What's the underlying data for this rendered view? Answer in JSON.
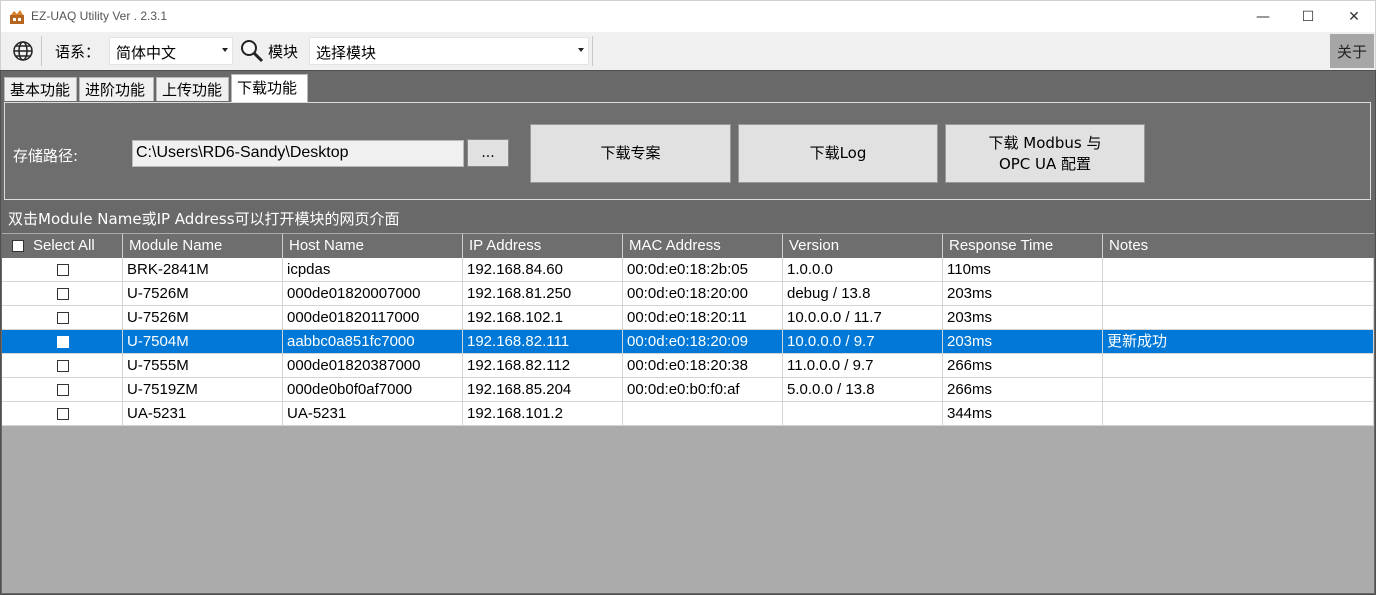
{
  "window": {
    "title": "EZ-UAQ Utility Ver . 2.3.1",
    "minimize_glyph": "—",
    "maximize_glyph": "☐",
    "close_glyph": "✕"
  },
  "toolbar": {
    "language_label": "语系：",
    "language_value": "简体中文",
    "module_label": "模块",
    "module_value": "选择模块",
    "about_label": "关于",
    "globe_icon": "globe-icon",
    "search_icon": "magnifier-icon"
  },
  "tabs": [
    {
      "label": "基本功能",
      "active": false
    },
    {
      "label": "进阶功能",
      "active": false
    },
    {
      "label": "上传功能",
      "active": false
    },
    {
      "label": "下载功能",
      "active": true
    }
  ],
  "download_panel": {
    "path_label": "存储路径:",
    "path_value": "C:\\Users\\RD6-Sandy\\Desktop",
    "browse_label": "...",
    "btn_project": "下载专案",
    "btn_log": "下载Log",
    "btn_modbus_line1": "下载 Modbus 与",
    "btn_modbus_line2": "OPC UA 配置"
  },
  "hint": "双击Module Name或IP Address可以打开模块的网页介面",
  "table": {
    "columns": [
      "Select All",
      "Module Name",
      "Host Name",
      "IP Address",
      "MAC Address",
      "Version",
      "Response Time",
      "Notes"
    ],
    "rows": [
      {
        "module": "BRK-2841M",
        "host": "icpdas",
        "ip": "192.168.84.60",
        "mac": "00:0d:e0:18:2b:05",
        "version": "1.0.0.0",
        "response": "110ms",
        "notes": "",
        "selected": false
      },
      {
        "module": "U-7526M",
        "host": "000de01820007000",
        "ip": "192.168.81.250",
        "mac": "00:0d:e0:18:20:00",
        "version": "debug / 13.8",
        "response": "203ms",
        "notes": "",
        "selected": false
      },
      {
        "module": "U-7526M",
        "host": "000de01820117000",
        "ip": "192.168.102.1",
        "mac": "00:0d:e0:18:20:11",
        "version": "10.0.0.0 / 11.7",
        "response": "203ms",
        "notes": "",
        "selected": false
      },
      {
        "module": "U-7504M",
        "host": "aabbc0a851fc7000",
        "ip": "192.168.82.111",
        "mac": "00:0d:e0:18:20:09",
        "version": "10.0.0.0 / 9.7",
        "response": "203ms",
        "notes": "更新成功",
        "selected": true
      },
      {
        "module": "U-7555M",
        "host": "000de01820387000",
        "ip": "192.168.82.112",
        "mac": "00:0d:e0:18:20:38",
        "version": "11.0.0.0 / 9.7",
        "response": "266ms",
        "notes": "",
        "selected": false
      },
      {
        "module": "U-7519ZM",
        "host": "000de0b0f0af7000",
        "ip": "192.168.85.204",
        "mac": "00:0d:e0:b0:f0:af",
        "version": "5.0.0.0 / 13.8",
        "response": "266ms",
        "notes": "",
        "selected": false
      },
      {
        "module": "UA-5231",
        "host": "UA-5231",
        "ip": "192.168.101.2",
        "mac": "",
        "version": "",
        "response": "344ms",
        "notes": "",
        "selected": false
      }
    ]
  },
  "colors": {
    "selection": "#0078d7",
    "dark_panel": "#6e6e6e",
    "grid_empty": "#ababab"
  }
}
